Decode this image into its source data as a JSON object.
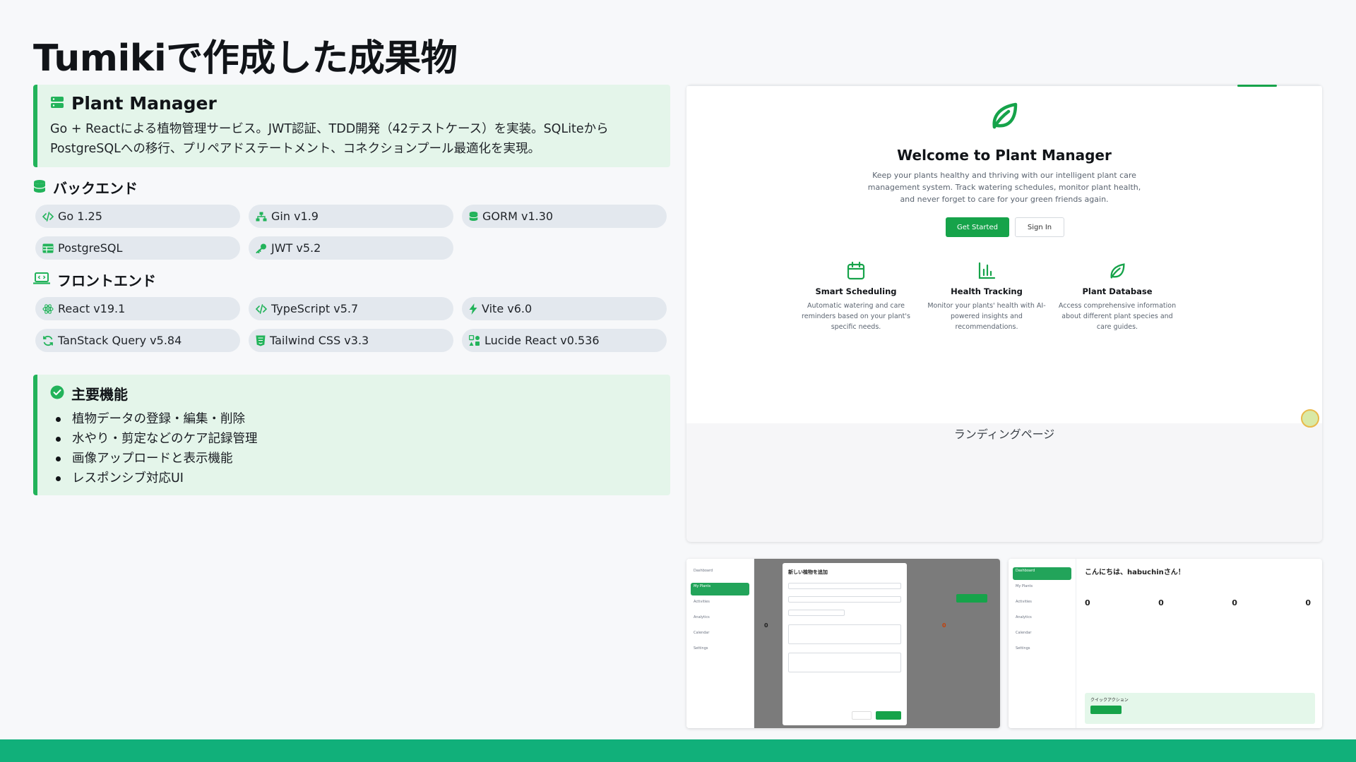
{
  "page": {
    "title": "Tumikiで作成した成果物"
  },
  "project": {
    "title": "Plant Manager",
    "description": "Go + Reactによる植物管理サービス。JWT認証、TDD開発（42テストケース）を実装。SQLiteからPostgreSQLへの移行、プリペアドステートメント、コネクションプール最適化を実現。"
  },
  "backend": {
    "title": "バックエンド",
    "tags": [
      {
        "label": "Go 1.25",
        "icon": "code-icon"
      },
      {
        "label": "Gin v1.9",
        "icon": "network-icon"
      },
      {
        "label": "GORM v1.30",
        "icon": "database-icon"
      },
      {
        "label": "PostgreSQL",
        "icon": "table-icon"
      },
      {
        "label": "JWT v5.2",
        "icon": "key-icon"
      }
    ]
  },
  "frontend": {
    "title": "フロントエンド",
    "tags": [
      {
        "label": "React v19.1",
        "icon": "atom-icon"
      },
      {
        "label": "TypeScript v5.7",
        "icon": "code-icon"
      },
      {
        "label": "Vite v6.0",
        "icon": "bolt-icon"
      },
      {
        "label": "TanStack Query v5.84",
        "icon": "refresh-icon"
      },
      {
        "label": "Tailwind CSS v3.3",
        "icon": "css-icon"
      },
      {
        "label": "Lucide React v0.536",
        "icon": "shapes-icon"
      }
    ]
  },
  "features": {
    "title": "主要機能",
    "items": [
      "植物データの登録・編集・削除",
      "水やり・剪定などのケア記録管理",
      "画像アップロードと表示機能",
      "レスポンシブ対応UI"
    ]
  },
  "landing": {
    "title": "Welcome to Plant Manager",
    "description": "Keep your plants healthy and thriving with our intelligent plant care management system. Track watering schedules, monitor plant health, and never forget to care for your green friends again.",
    "primary_button": "Get Started",
    "secondary_button": "Sign In",
    "features": [
      {
        "title": "Smart Scheduling",
        "description": "Automatic watering and care reminders based on your plant's specific needs.",
        "icon": "calendar-icon"
      },
      {
        "title": "Health Tracking",
        "description": "Monitor your plants' health with AI-powered insights and recommendations.",
        "icon": "bar-chart-icon"
      },
      {
        "title": "Plant Database",
        "description": "Access comprehensive information about different plant species and care guides.",
        "icon": "leaf-icon"
      }
    ],
    "caption": "ランディングページ"
  },
  "thumb_modal": {
    "title": "新しい植物を追加",
    "nav": [
      "Dashboard",
      "My Plants",
      "Activities",
      "Analytics",
      "Calendar",
      "Settings"
    ],
    "stats": [
      "0",
      "0"
    ]
  },
  "thumb_dashboard": {
    "greeting": "こんにちは、habuchinさん！",
    "nav": [
      "Dashboard",
      "My Plants",
      "Activities",
      "Analytics",
      "Calendar",
      "Settings"
    ],
    "stats": [
      "0",
      "0",
      "0",
      "0"
    ],
    "quick_actions": "クイックアクション"
  },
  "colors": {
    "accent": "#22b35a",
    "callout_bg": "#e4f5ea",
    "tag_bg": "#e3e8ee",
    "footer": "#11b07a"
  }
}
